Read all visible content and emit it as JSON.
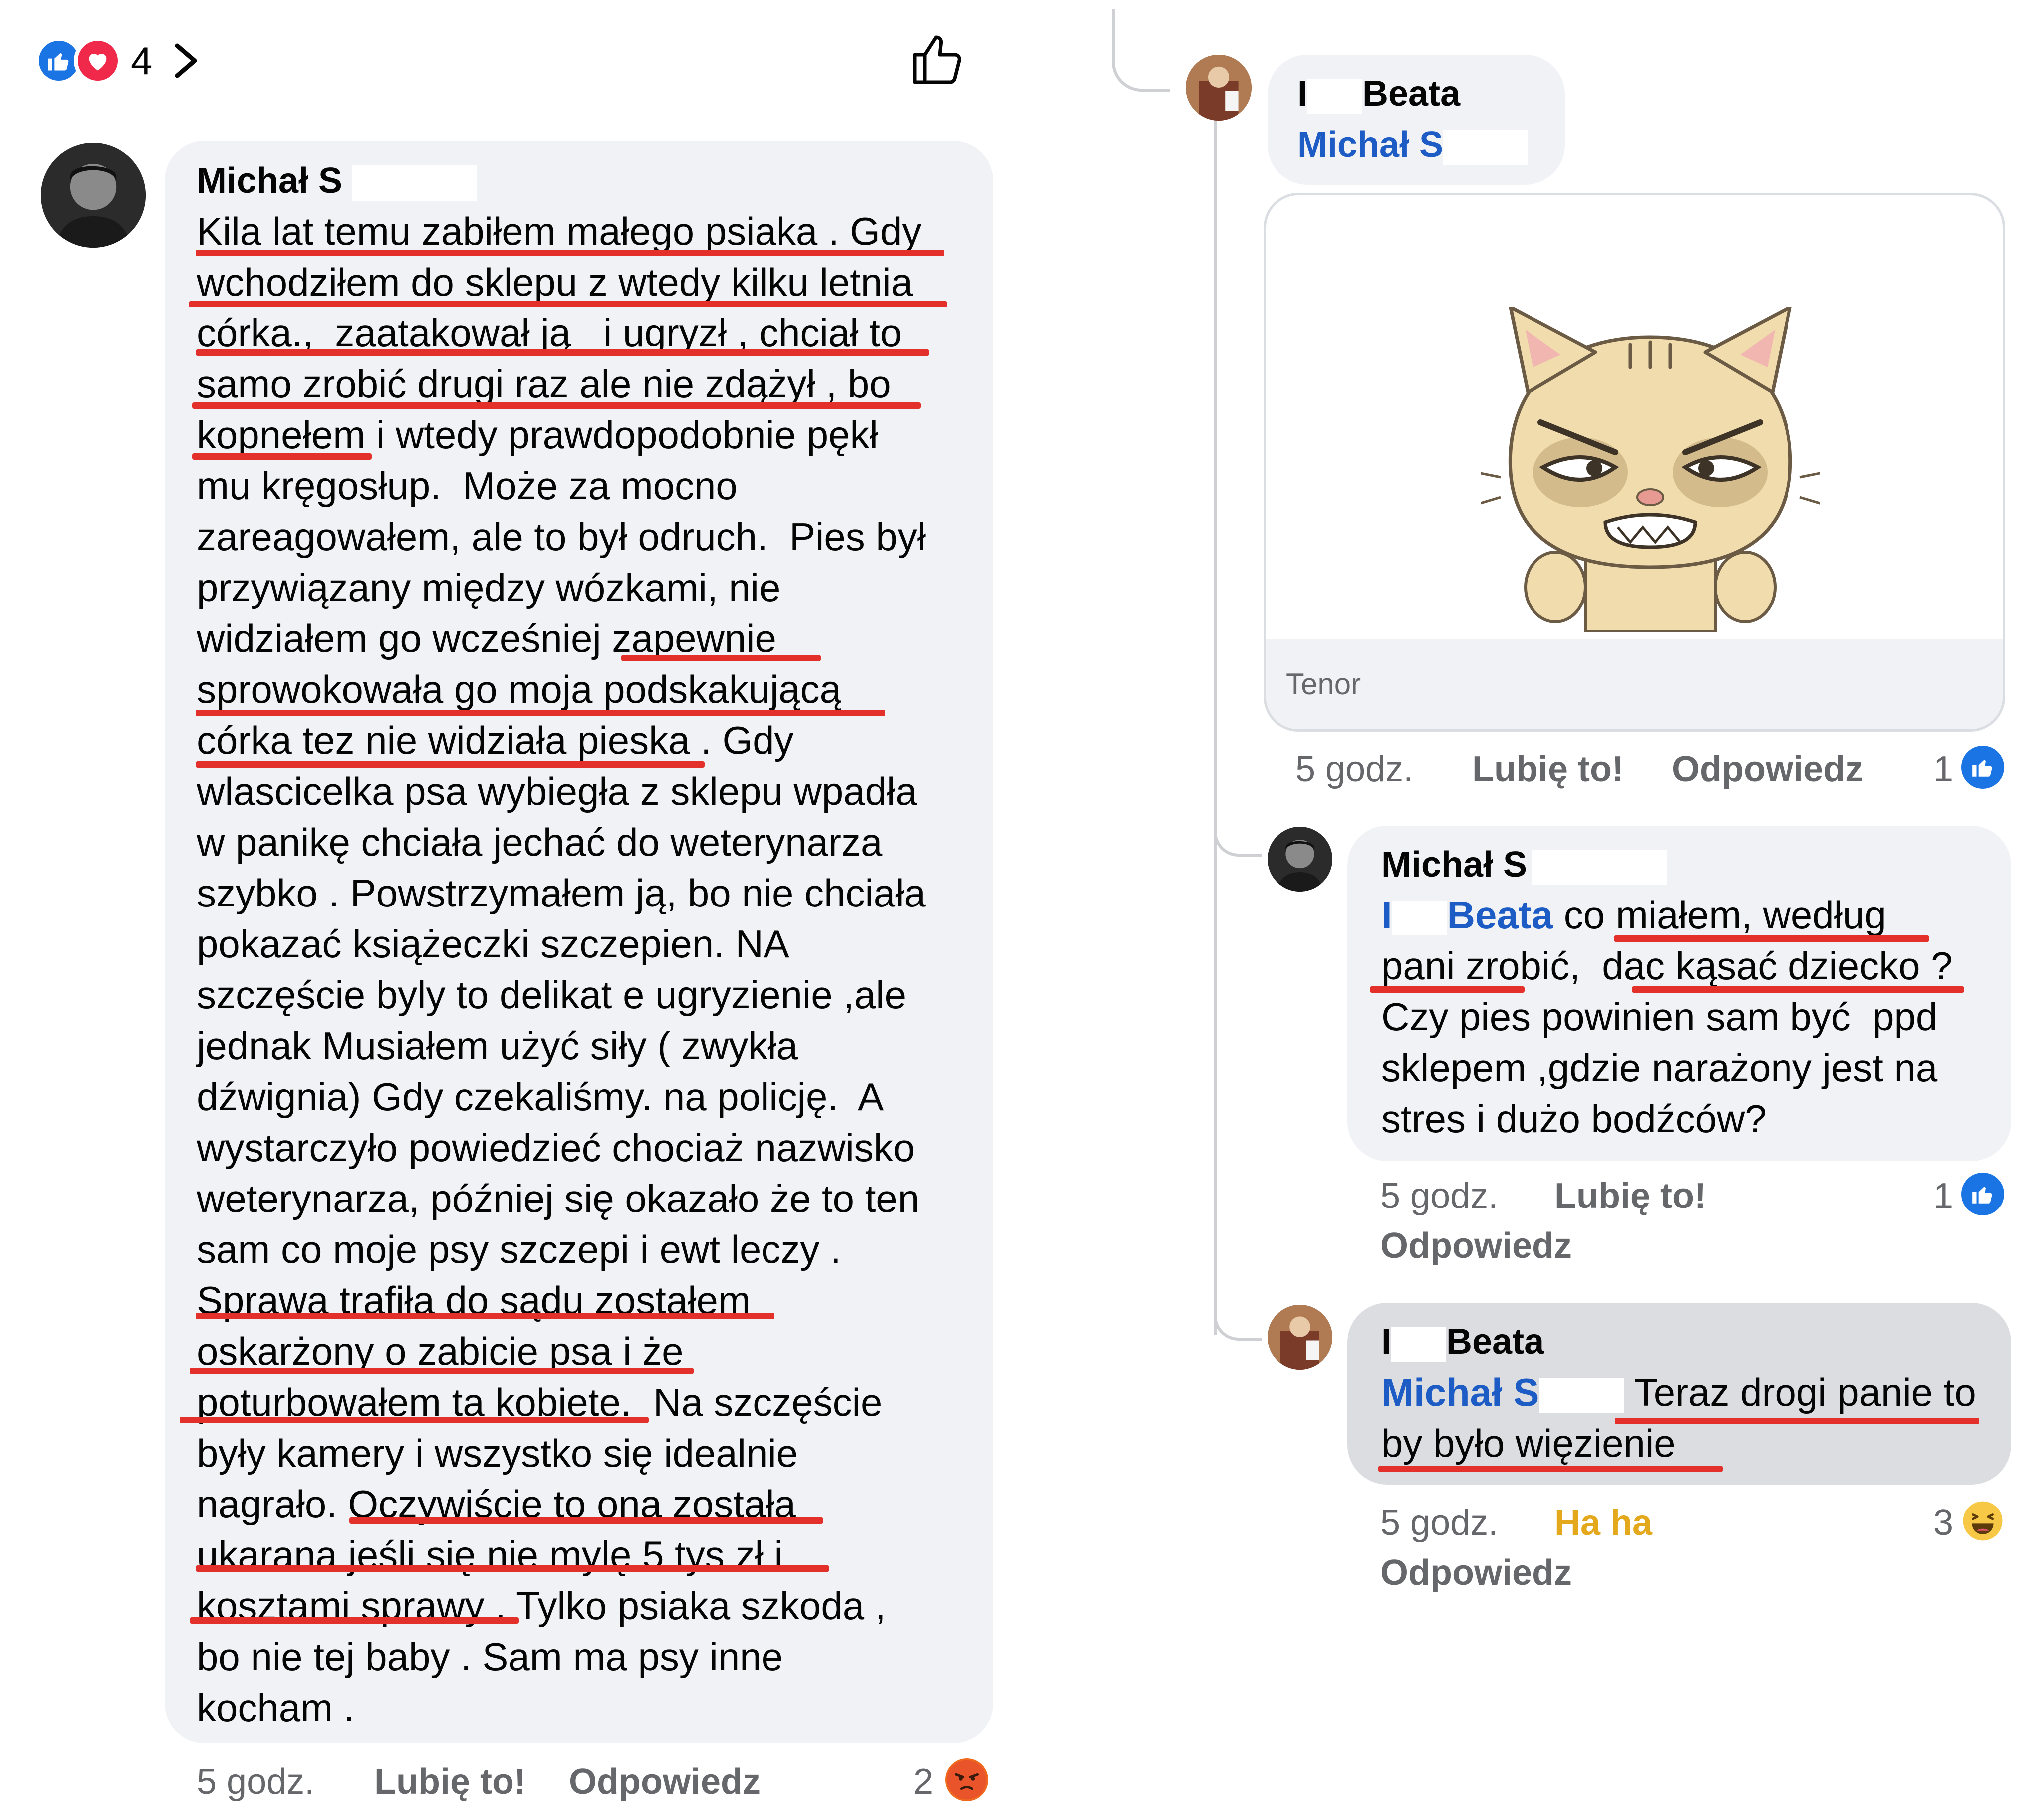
{
  "reactions_bar": {
    "count": "4"
  },
  "main_comment": {
    "author": "Michał S",
    "lines": [
      "Kila lat temu zabiłem małego psiaka . Gdy",
      "wchodziłem do sklepu z wtedy kilku letnia",
      "córka.,  zaatakował ją   i ugryzł , chciał to",
      "samo zrobić drugi raz ale nie zdążył , bo",
      "kopnełem i wtedy prawdopodobnie pękł",
      "mu kręgosłup.  Może za mocno",
      "zareagowałem, ale to był odruch.  Pies był",
      "przywiązany między wózkami, nie",
      "widziałem go wcześniej zapewnie",
      "sprowokowała go moja podskakującą",
      "córka tez nie widziała pieska . Gdy",
      "wlascicelka psa wybiegła z sklepu wpadła",
      "w panikę chciała jechać do weterynarza",
      "szybko . Powstrzymałem ją, bo nie chciała",
      "pokazać książeczki szczepien. NA",
      "szczęście byly to delikat e ugryzienie ,ale",
      "jednak Musiałem użyć siły ( zwykła",
      "dźwignia) Gdy czekaliśmy. na policję.  A",
      "wystarczyło powiedzieć chociaż nazwisko",
      "weterynarza, później się okazało że to ten",
      "sam co moje psy szczepi i ewt leczy .",
      "Sprawa trafiła do sądu zostałem",
      "oskarżony o zabicie psa i że",
      "poturbowałem ta kobiete.  Na szczęście",
      "były kamery i wszystko się idealnie",
      "nagrało. Oczywiście to ona została",
      "ukarana jeśli się nie mylę 5 tys zł i",
      "kosztami sprawy . Tylko psiaka szkoda ,",
      "bo nie tej baby . Sam ma psy inne",
      "kocham ."
    ],
    "time": "5 godz.",
    "like": "Lubię to!",
    "reply": "Odpowiedz",
    "reaction_count": "2",
    "reaction_icon": "angry-emoji"
  },
  "reply1": {
    "author_initial": "I",
    "author_name": "Beata",
    "mention": "Michał S",
    "gif_source": "Tenor",
    "time": "5 godz.",
    "like": "Lubię to!",
    "reply": "Odpowiedz",
    "reaction_count": "1",
    "reaction_icon": "like-icon"
  },
  "reply2": {
    "author": "Michał S",
    "mention_initial": "I",
    "mention_name": "Beata",
    "text_line1": " co miałem, według",
    "lines": [
      "pani zrobić,  dac kąsać dziecko ?",
      "Czy pies powinien sam być  ppd",
      "sklepem ,gdzie narażony jest na",
      "stres i dużo bodźców?"
    ],
    "time": "5 godz.",
    "like": "Lubię to!",
    "reply": "Odpowiedz",
    "reaction_count": "1",
    "reaction_icon": "like-icon"
  },
  "reply3": {
    "author_initial": "I",
    "author_name": "Beata",
    "mention": "Michał S",
    "text_line1": "Teraz drogi panie to",
    "text_line2": "by było więzienie",
    "time": "5 godz.",
    "like": "Ha ha",
    "reply": "Odpowiedz",
    "reaction_count": "3",
    "reaction_icon": "haha-emoji",
    "like_color": "#e3a81c"
  }
}
